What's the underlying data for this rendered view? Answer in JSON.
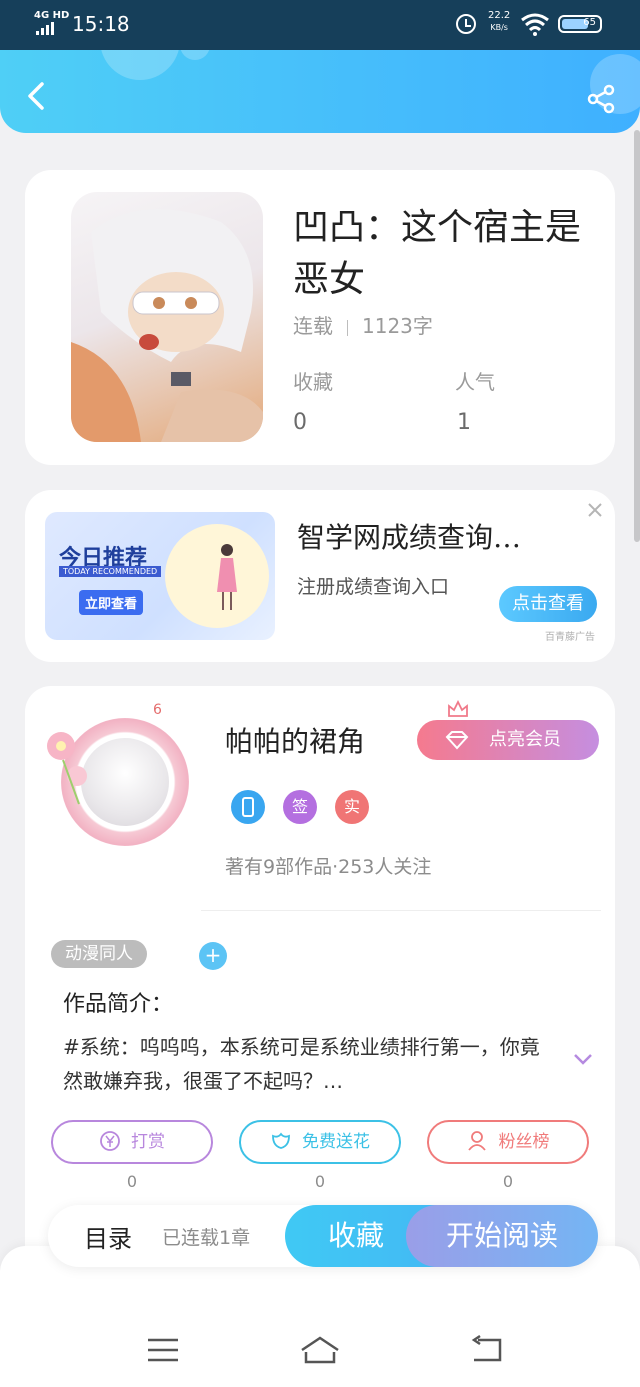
{
  "status_bar": {
    "network": "4G HD",
    "time": "15:18",
    "speed_value": "22.2",
    "speed_unit": "KB/s",
    "battery_level": "65"
  },
  "header": {
    "back_icon": "chevron-left-icon",
    "share_icon": "share-icon"
  },
  "book": {
    "title": "凹凸：这个宿主是恶女",
    "status": "连载",
    "word_count": "1123字",
    "collect_label": "收藏",
    "collect_value": "0",
    "popularity_label": "人气",
    "popularity_value": "1"
  },
  "ad": {
    "image_title": "今日推荐",
    "image_subtitle": "TODAY RECOMMENDED",
    "image_button": "立即查看",
    "title": "智学网成绩查询…",
    "description": "注册成绩查询入口",
    "cta": "点击查看",
    "source": "百青藤广告"
  },
  "author": {
    "level": "6",
    "name": "帕帕的裙角",
    "vip_button": "点亮会员",
    "badges": [
      {
        "label": "",
        "color": "#39a6f0",
        "icon": "phone-icon"
      },
      {
        "label": "签",
        "color": "#b46fe0"
      },
      {
        "label": "实",
        "color": "#f07575"
      }
    ],
    "stats": "著有9部作品·253人关注",
    "tag": "动漫同人",
    "add_tag": "+",
    "intro_label": "作品简介：",
    "intro_text": "#系统：呜呜呜，本系统可是系统业绩排行第一，你竟然敢嫌弃我，很蛋了不起吗？…",
    "actions": [
      {
        "label": "打赏",
        "count": "0",
        "color": "#b887dd",
        "icon": "yen-icon"
      },
      {
        "label": "免费送花",
        "count": "0",
        "color": "#3cc1e6",
        "icon": "flower-icon"
      },
      {
        "label": "粉丝榜",
        "count": "0",
        "color": "#f07b7b",
        "icon": "user-icon"
      }
    ]
  },
  "bottom_bar": {
    "toc": "目录",
    "status": "已连载1章",
    "collect": "收藏",
    "read": "开始阅读"
  },
  "nav": {
    "items": [
      "menu-icon",
      "home-icon",
      "back-icon"
    ]
  }
}
